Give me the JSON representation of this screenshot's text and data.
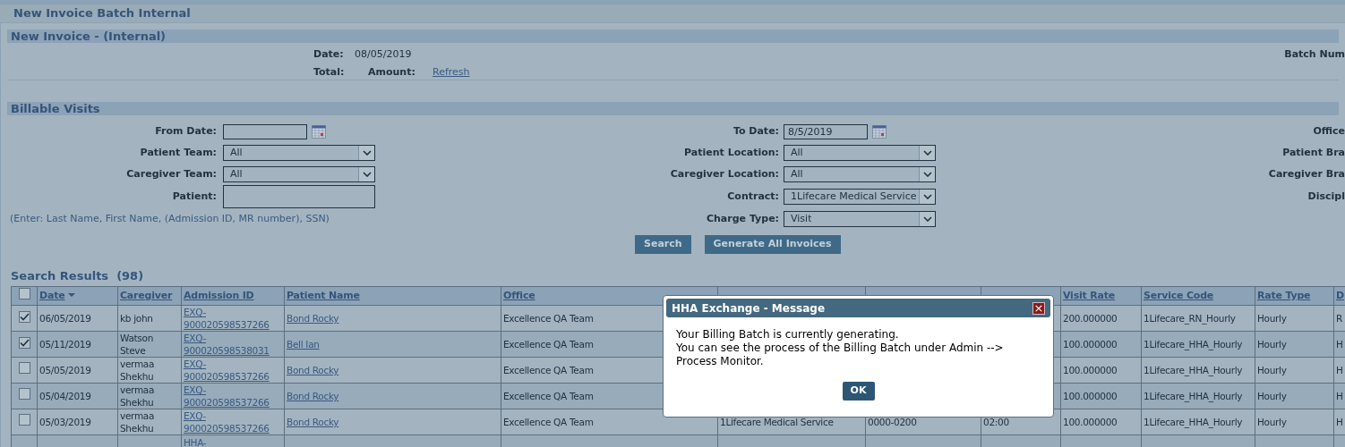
{
  "page_title": "New Invoice Batch Internal",
  "invoice": {
    "title": "New Invoice - (Internal)",
    "date_label": "Date:",
    "date": "08/05/2019",
    "total_label": "Total:",
    "amount_label": "Amount:",
    "refresh_link": "Refresh",
    "batch_label": "Batch Num"
  },
  "billable": {
    "title": "Billable Visits",
    "left_fields": [
      {
        "label": "From Date:",
        "kind": "date"
      },
      {
        "label": "Patient Team:",
        "kind": "select",
        "value": "All"
      },
      {
        "label": "Caregiver Team:",
        "kind": "select",
        "value": "All"
      },
      {
        "label": "Patient:",
        "kind": "text"
      }
    ],
    "hint": "(Enter: Last Name, First Name, (Admission ID, MR number), SSN)",
    "middle_fields": [
      {
        "label": "To Date:",
        "kind": "date",
        "value": "8/5/2019"
      },
      {
        "label": "Patient Location:",
        "kind": "select",
        "value": "All"
      },
      {
        "label": "Caregiver Location:",
        "kind": "select",
        "value": "All"
      },
      {
        "label": "Contract:",
        "kind": "select",
        "value": "1Lifecare Medical Service"
      },
      {
        "label": "Charge Type:",
        "kind": "select",
        "value": "Visit"
      }
    ],
    "right_labels": [
      "Office",
      "Patient Bra",
      "Caregiver Bra",
      "Discipl"
    ],
    "buttons": [
      "Search",
      "Generate All Invoices"
    ]
  },
  "results": {
    "title": "Search Results  (98)",
    "all_checked": false,
    "columns": [
      "Date",
      "Caregiver",
      "Admission ID",
      "Patient Name",
      "Office",
      null,
      null,
      null,
      "Visit Rate",
      "Service Code",
      "Rate Type",
      "D"
    ],
    "rows": [
      {
        "checked": true,
        "date": "06/05/2019",
        "caregiver": "kb john",
        "admission_id": "EXQ-900020598537266",
        "patient": "Bond Rocky",
        "office": "Excellence QA Team",
        "rate": "200.000000",
        "service_code": "1Lifecare_RN_Hourly",
        "rate_type": "Hourly",
        "column_12": "R"
      },
      {
        "checked": true,
        "date": "05/11/2019",
        "caregiver": "Watson Steve",
        "admission_id": "EXQ-900020598538031",
        "patient": "Bell Ian",
        "office": "Excellence QA Team",
        "rate": "100.000000",
        "service_code": "1Lifecare_HHA_Hourly",
        "rate_type": "Hourly",
        "column_12": "H"
      },
      {
        "checked": false,
        "date": "05/05/2019",
        "caregiver": "vermaa Shekhu",
        "admission_id": "EXQ-900020598537266",
        "patient": "Bond Rocky",
        "office": "Excellence QA Team",
        "rate": "100.000000",
        "service_code": "1Lifecare_HHA_Hourly",
        "rate_type": "Hourly",
        "column_12": "H"
      },
      {
        "checked": false,
        "date": "05/04/2019",
        "caregiver": "vermaa Shekhu",
        "admission_id": "EXQ-900020598537266",
        "patient": "Bond Rocky",
        "office": "Excellence QA Team",
        "rate": "100.000000",
        "service_code": "1Lifecare_HHA_Hourly",
        "rate_type": "Hourly",
        "column_12": "H"
      },
      {
        "checked": false,
        "date": "05/03/2019",
        "caregiver": "vermaa Shekhu",
        "admission_id": "EXQ-900020598537266",
        "patient": "Bond Rocky",
        "office": "Excellence QA Team",
        "contract": "1Lifecare Medical Service",
        "visit": "0000-0200",
        "visit_hrs": "02:00",
        "rate": "100.000000",
        "service_code": "1Lifecare_HHA_Hourly",
        "rate_type": "Hourly",
        "column_12": "H"
      },
      {
        "admission_id": "HHA-"
      }
    ]
  },
  "dialog": {
    "title": "HHA Exchange - Message",
    "close": "×",
    "lines": [
      "Your Billing Batch is currently generating.",
      "You can see the process of the Billing Batch under Admin -->",
      "Process Monitor."
    ],
    "button": "OK"
  }
}
